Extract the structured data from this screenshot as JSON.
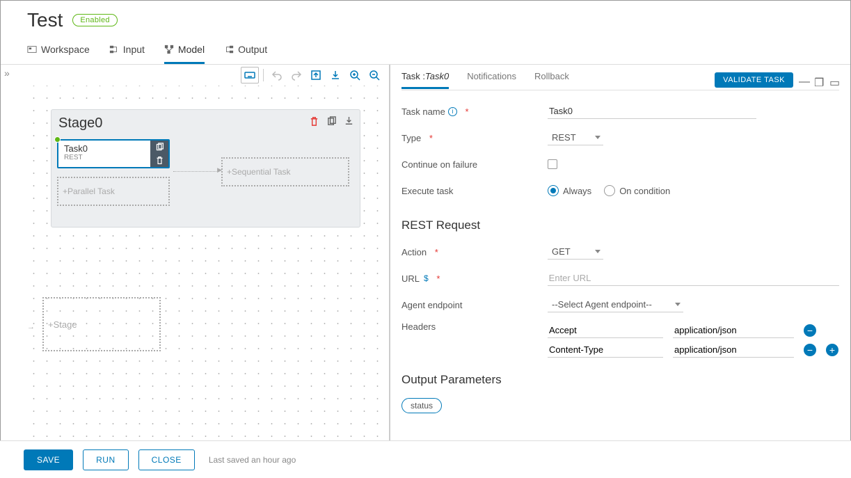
{
  "page": {
    "title": "Test",
    "status": "Enabled"
  },
  "main_tabs": {
    "items": [
      {
        "label": "Workspace",
        "icon": "workspace"
      },
      {
        "label": "Input",
        "icon": "input"
      },
      {
        "label": "Model",
        "icon": "model"
      },
      {
        "label": "Output",
        "icon": "output"
      }
    ],
    "active": 2
  },
  "canvas": {
    "stage": {
      "title": "Stage0",
      "task": {
        "name": "Task0",
        "type": "REST"
      },
      "parallel_placeholder": "+Parallel Task",
      "sequential_placeholder": "+Sequential Task"
    },
    "stage_placeholder": "+Stage"
  },
  "panel_tabs": {
    "items": [
      "Task :",
      "Notifications",
      "Rollback"
    ],
    "task_name_em": "Task0",
    "active": 0
  },
  "validate_btn": "VALIDATE TASK",
  "form": {
    "task_name_label": "Task name",
    "task_name_value": "Task0",
    "type_label": "Type",
    "type_value": "REST",
    "continue_label": "Continue on failure",
    "execute_label": "Execute task",
    "execute_options": {
      "always": "Always",
      "on_condition": "On condition"
    }
  },
  "rest": {
    "title": "REST Request",
    "action_label": "Action",
    "action_value": "GET",
    "url_label": "URL",
    "url_placeholder": "Enter URL",
    "agent_label": "Agent endpoint",
    "agent_value": "--Select Agent endpoint--",
    "headers_label": "Headers",
    "headers": [
      {
        "key": "Accept",
        "value": "application/json"
      },
      {
        "key": "Content-Type",
        "value": "application/json"
      }
    ]
  },
  "output": {
    "title": "Output Parameters",
    "params": [
      "status"
    ]
  },
  "footer": {
    "save": "SAVE",
    "run": "RUN",
    "close": "CLOSE",
    "hint": "Last saved an hour ago"
  }
}
